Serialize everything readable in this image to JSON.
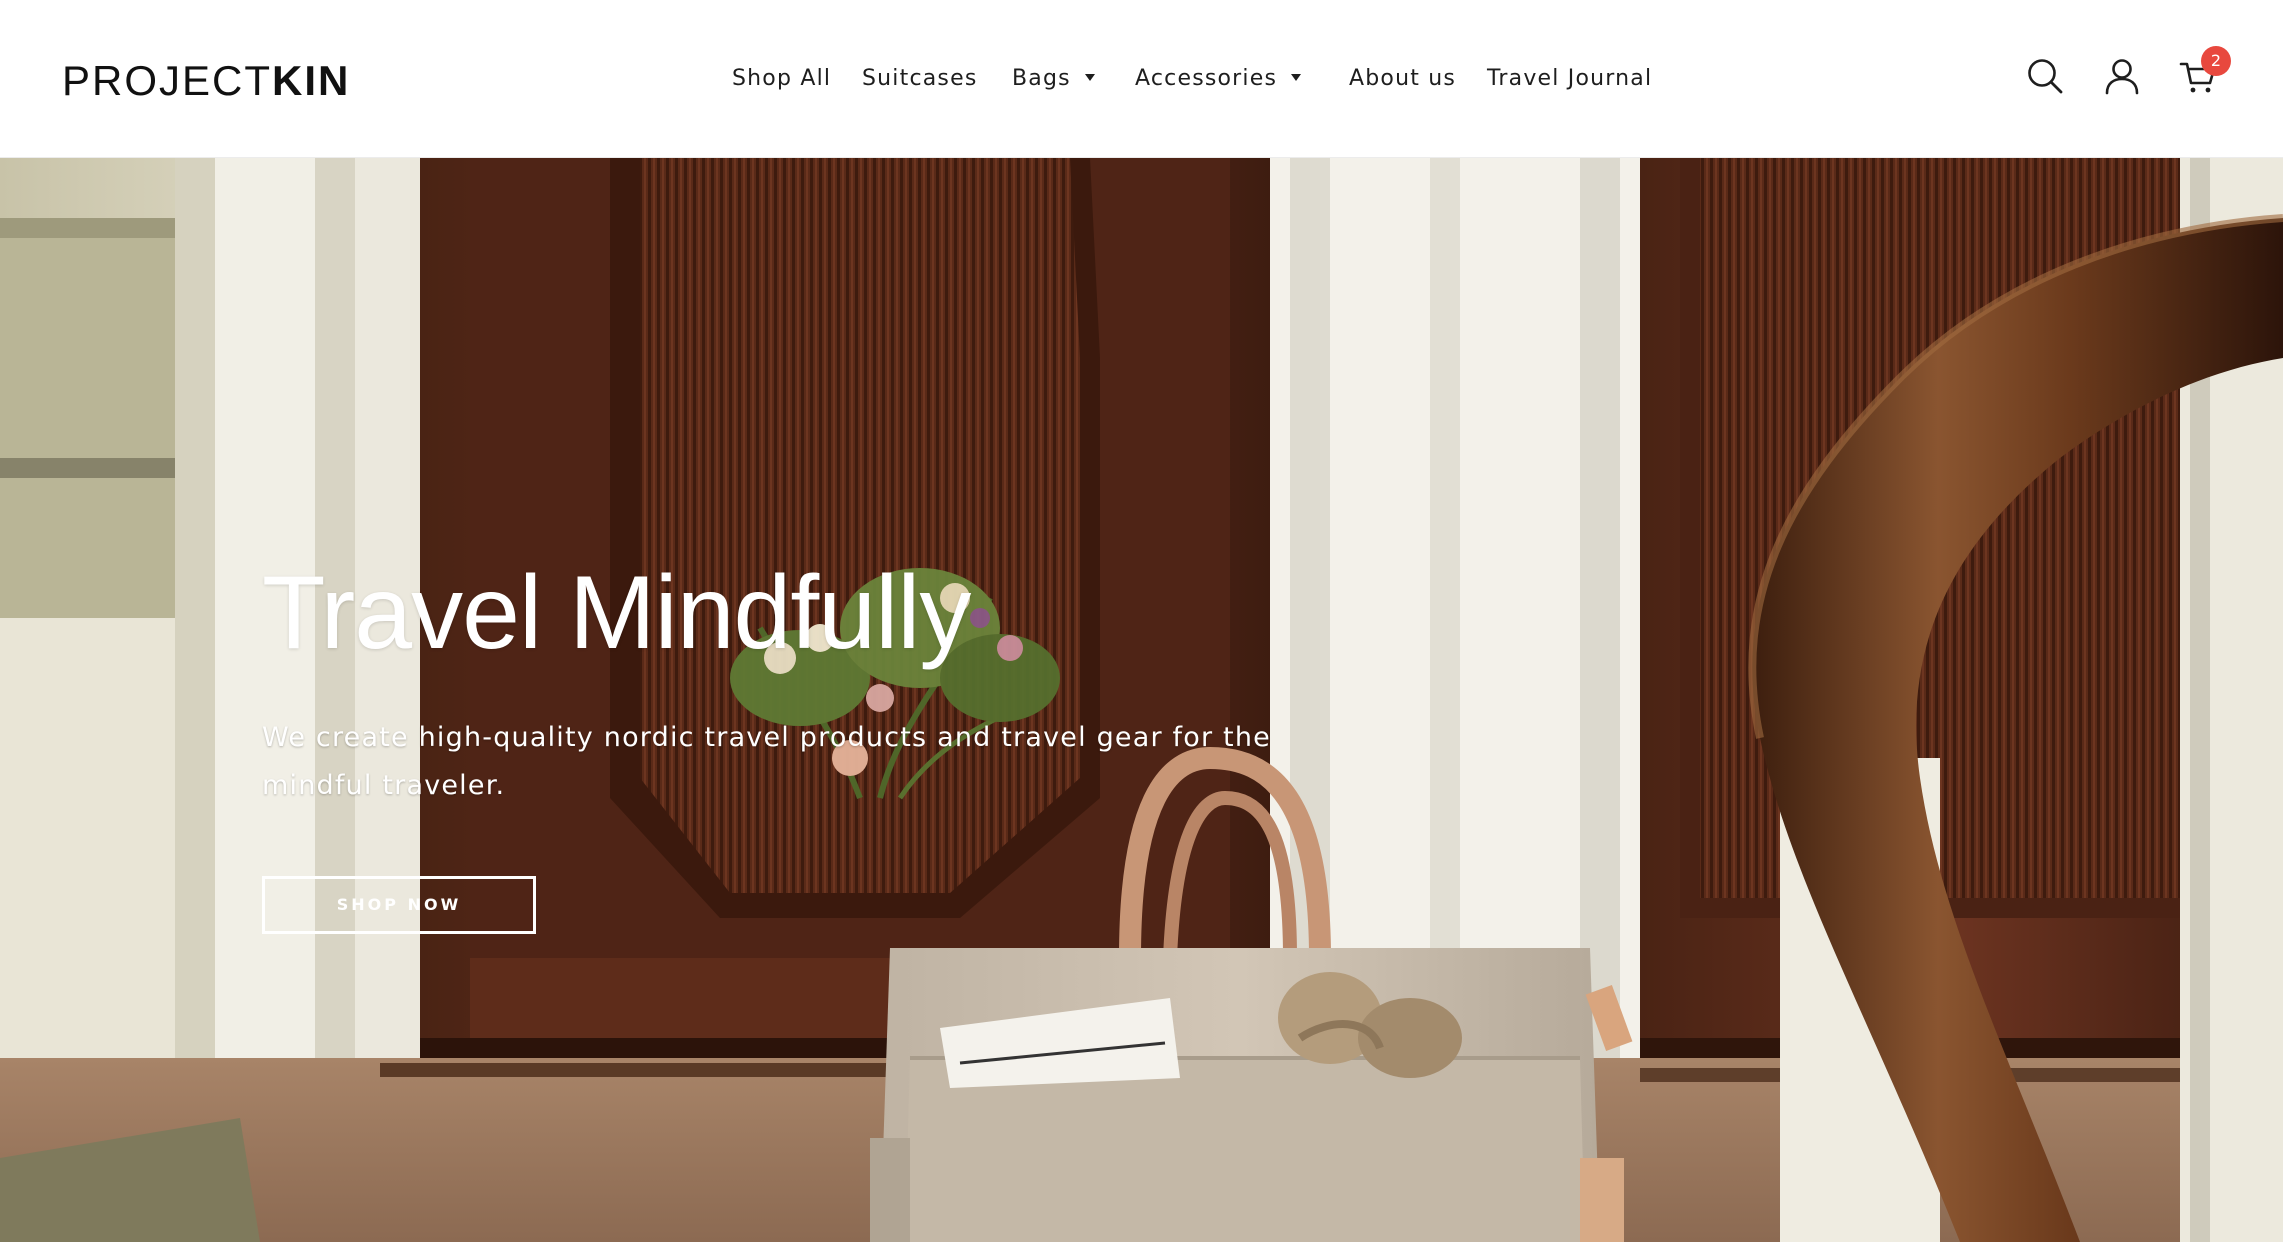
{
  "brand": {
    "logo_light": "PROJECT",
    "logo_bold": "KIN"
  },
  "nav": {
    "items": [
      {
        "label": "Shop All",
        "has_dropdown": false
      },
      {
        "label": "Suitcases",
        "has_dropdown": false
      },
      {
        "label": "Bags",
        "has_dropdown": true
      },
      {
        "label": "Accessories",
        "has_dropdown": true
      },
      {
        "label": "About us",
        "has_dropdown": false
      },
      {
        "label": "Travel Journal",
        "has_dropdown": false
      }
    ]
  },
  "header_icons": {
    "search": "search-icon",
    "account": "user-icon",
    "cart": "cart-icon",
    "cart_count": "2"
  },
  "hero": {
    "title": "Travel Mindfully",
    "subtitle": "We create high-quality nordic travel products and travel gear for the mindful traveler.",
    "cta_label": "SHOP NOW"
  },
  "colors": {
    "badge": "#e8483e",
    "text_dark": "#1e1e1e",
    "hero_text": "#ffffff"
  }
}
